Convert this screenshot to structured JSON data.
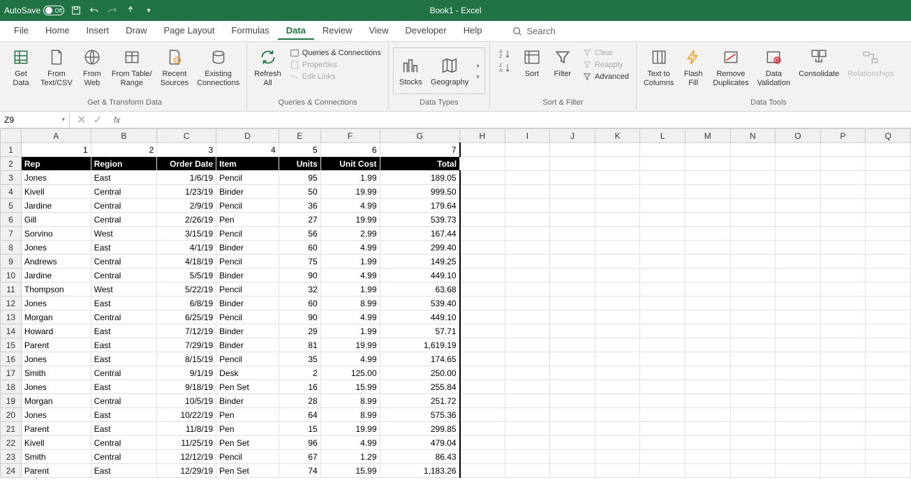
{
  "titlebar": {
    "autosave_label": "AutoSave",
    "autosave_state": "Off",
    "title": "Book1 - Excel"
  },
  "menu": {
    "tabs": [
      "File",
      "Home",
      "Insert",
      "Draw",
      "Page Layout",
      "Formulas",
      "Data",
      "Review",
      "View",
      "Developer",
      "Help"
    ],
    "active_index": 6,
    "search_label": "Search"
  },
  "ribbon": {
    "groups": {
      "get_transform": {
        "label": "Get & Transform Data",
        "get_data": "Get\nData",
        "from_textcsv": "From\nText/CSV",
        "from_web": "From\nWeb",
        "from_table": "From Table/\nRange",
        "recent_sources": "Recent\nSources",
        "existing_conn": "Existing\nConnections"
      },
      "queries": {
        "label": "Queries & Connections",
        "refresh_all": "Refresh\nAll",
        "queries_conn": "Queries & Connections",
        "properties": "Properties",
        "edit_links": "Edit Links"
      },
      "data_types": {
        "label": "Data Types",
        "stocks": "Stocks",
        "geography": "Geography"
      },
      "sort_filter": {
        "label": "Sort & Filter",
        "sort": "Sort",
        "filter": "Filter",
        "clear": "Clear",
        "reapply": "Reapply",
        "advanced": "Advanced"
      },
      "data_tools": {
        "label": "Data Tools",
        "text_to_cols": "Text to\nColumns",
        "flash_fill": "Flash\nFill",
        "remove_dupes": "Remove\nDuplicates",
        "data_validation": "Data\nValidation",
        "consolidate": "Consolidate",
        "relationships": "Relationships"
      }
    }
  },
  "namebox": {
    "ref": "Z9"
  },
  "sheet": {
    "column_letters": [
      "A",
      "B",
      "C",
      "D",
      "E",
      "F",
      "G",
      "H",
      "I",
      "J",
      "K",
      "L",
      "M",
      "N",
      "O",
      "P",
      "Q"
    ],
    "row1": [
      "1",
      "2",
      "3",
      "4",
      "5",
      "6",
      "7"
    ],
    "headers": [
      "Rep",
      "Region",
      "Order Date",
      "Item",
      "Units",
      "Unit Cost",
      "Total"
    ],
    "rows": [
      [
        "Jones",
        "East",
        "1/6/19",
        "Pencil",
        "95",
        "1.99",
        "189.05"
      ],
      [
        "Kivell",
        "Central",
        "1/23/19",
        "Binder",
        "50",
        "19.99",
        "999.50"
      ],
      [
        "Jardine",
        "Central",
        "2/9/19",
        "Pencil",
        "36",
        "4.99",
        "179.64"
      ],
      [
        "Gill",
        "Central",
        "2/26/19",
        "Pen",
        "27",
        "19.99",
        "539.73"
      ],
      [
        "Sorvino",
        "West",
        "3/15/19",
        "Pencil",
        "56",
        "2.99",
        "167.44"
      ],
      [
        "Jones",
        "East",
        "4/1/19",
        "Binder",
        "60",
        "4.99",
        "299.40"
      ],
      [
        "Andrews",
        "Central",
        "4/18/19",
        "Pencil",
        "75",
        "1.99",
        "149.25"
      ],
      [
        "Jardine",
        "Central",
        "5/5/19",
        "Binder",
        "90",
        "4.99",
        "449.10"
      ],
      [
        "Thompson",
        "West",
        "5/22/19",
        "Pencil",
        "32",
        "1.99",
        "63.68"
      ],
      [
        "Jones",
        "East",
        "6/8/19",
        "Binder",
        "60",
        "8.99",
        "539.40"
      ],
      [
        "Morgan",
        "Central",
        "6/25/19",
        "Pencil",
        "90",
        "4.99",
        "449.10"
      ],
      [
        "Howard",
        "East",
        "7/12/19",
        "Binder",
        "29",
        "1.99",
        "57.71"
      ],
      [
        "Parent",
        "East",
        "7/29/19",
        "Binder",
        "81",
        "19.99",
        "1,619.19"
      ],
      [
        "Jones",
        "East",
        "8/15/19",
        "Pencil",
        "35",
        "4.99",
        "174.65"
      ],
      [
        "Smith",
        "Central",
        "9/1/19",
        "Desk",
        "2",
        "125.00",
        "250.00"
      ],
      [
        "Jones",
        "East",
        "9/18/19",
        "Pen Set",
        "16",
        "15.99",
        "255.84"
      ],
      [
        "Morgan",
        "Central",
        "10/5/19",
        "Binder",
        "28",
        "8.99",
        "251.72"
      ],
      [
        "Jones",
        "East",
        "10/22/19",
        "Pen",
        "64",
        "8.99",
        "575.36"
      ],
      [
        "Parent",
        "East",
        "11/8/19",
        "Pen",
        "15",
        "19.99",
        "299.85"
      ],
      [
        "Kivell",
        "Central",
        "11/25/19",
        "Pen Set",
        "96",
        "4.99",
        "479.04"
      ],
      [
        "Smith",
        "Central",
        "12/12/19",
        "Pencil",
        "67",
        "1.29",
        "86.43"
      ],
      [
        "Parent",
        "East",
        "12/29/19",
        "Pen Set",
        "74",
        "15.99",
        "1,183.26"
      ]
    ]
  }
}
